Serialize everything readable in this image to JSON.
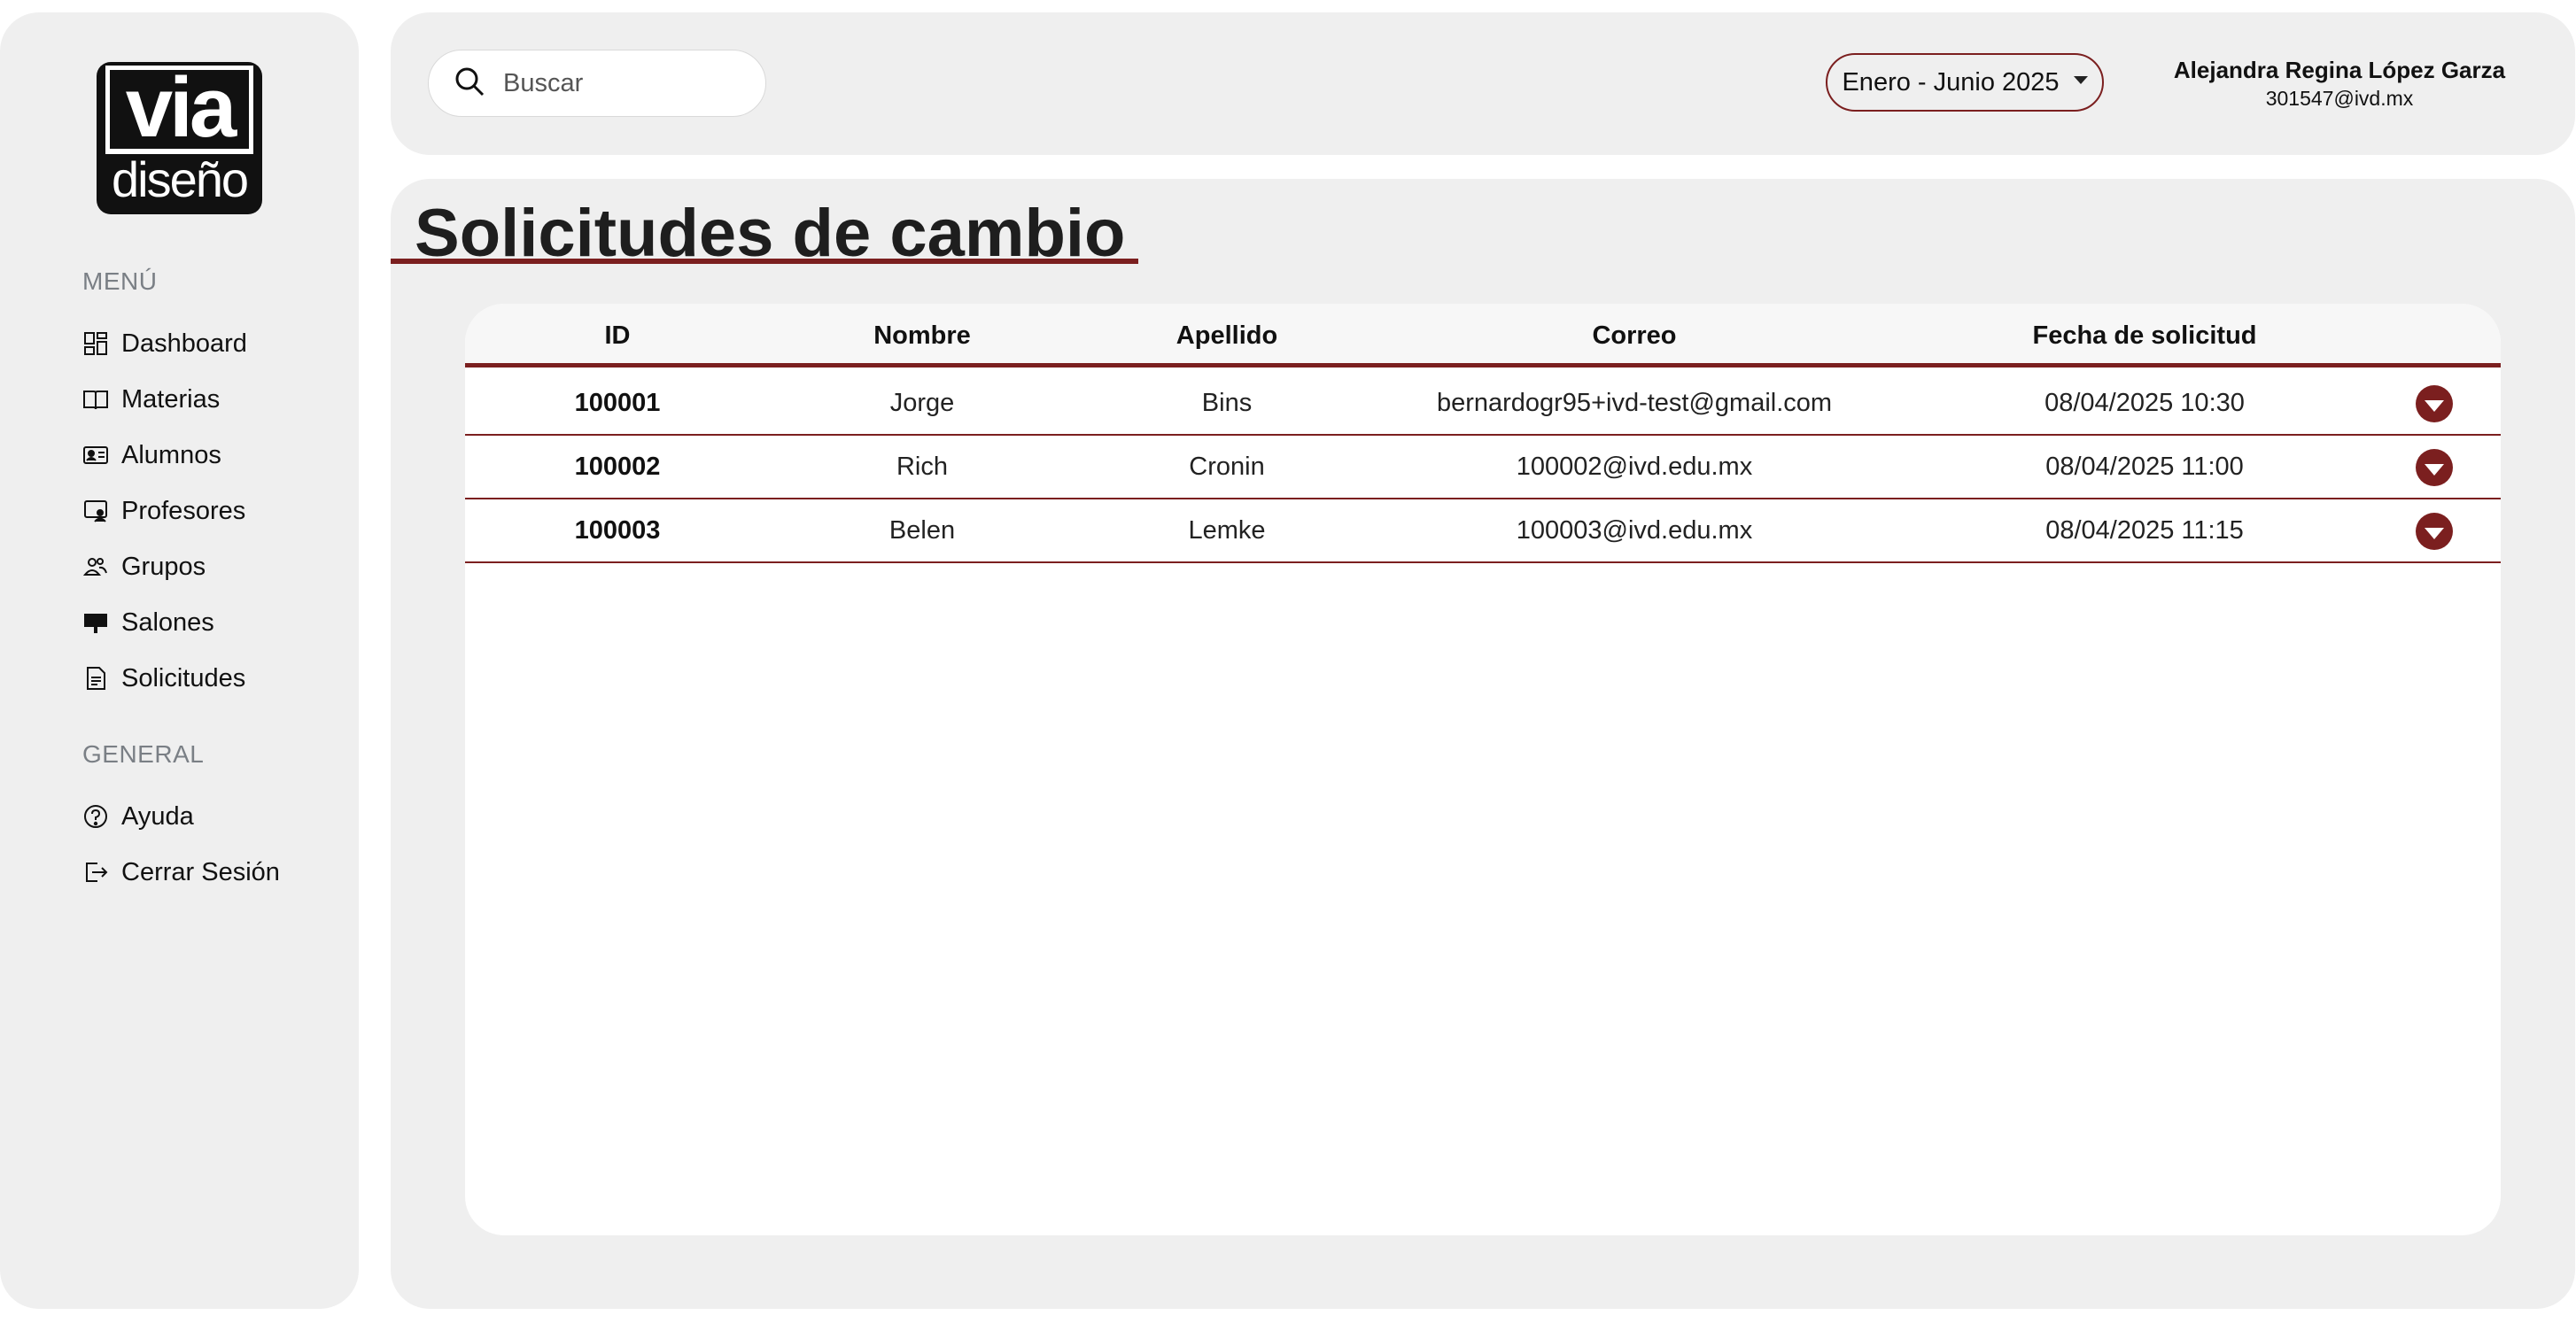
{
  "sidebar": {
    "logo": {
      "top": "via",
      "bottom": "diseño"
    },
    "menu_label": "MENÚ",
    "general_label": "GENERAL",
    "menu_items": [
      {
        "label": "Dashboard",
        "icon": "dashboard-icon"
      },
      {
        "label": "Materias",
        "icon": "book-icon"
      },
      {
        "label": "Alumnos",
        "icon": "id-card-icon"
      },
      {
        "label": "Profesores",
        "icon": "teacher-screen-icon"
      },
      {
        "label": "Grupos",
        "icon": "users-icon"
      },
      {
        "label": "Salones",
        "icon": "classroom-board-icon"
      },
      {
        "label": "Solicitudes",
        "icon": "document-icon"
      }
    ],
    "general_items": [
      {
        "label": "Ayuda",
        "icon": "help-circle-icon"
      },
      {
        "label": "Cerrar Sesión",
        "icon": "logout-icon"
      }
    ]
  },
  "header": {
    "search_placeholder": "Buscar",
    "period": "Enero - Junio 2025",
    "user": {
      "name": "Alejandra Regina López Garza",
      "email": "301547@ivd.mx"
    }
  },
  "main": {
    "title": "Solicitudes de cambio",
    "columns": [
      "ID",
      "Nombre",
      "Apellido",
      "Correo",
      "Fecha de solicitud"
    ],
    "rows": [
      {
        "id": "100001",
        "nombre": "Jorge",
        "apellido": "Bins",
        "correo": "bernardogr95+ivd-test@gmail.com",
        "fecha": "08/04/2025 10:30"
      },
      {
        "id": "100002",
        "nombre": "Rich",
        "apellido": "Cronin",
        "correo": "100002@ivd.edu.mx",
        "fecha": "08/04/2025 11:00"
      },
      {
        "id": "100003",
        "nombre": "Belen",
        "apellido": "Lemke",
        "correo": "100003@ivd.edu.mx",
        "fecha": "08/04/2025 11:15"
      }
    ]
  },
  "colors": {
    "accent": "#7b1f1f",
    "panel": "#efefef",
    "card": "#ffffff"
  }
}
